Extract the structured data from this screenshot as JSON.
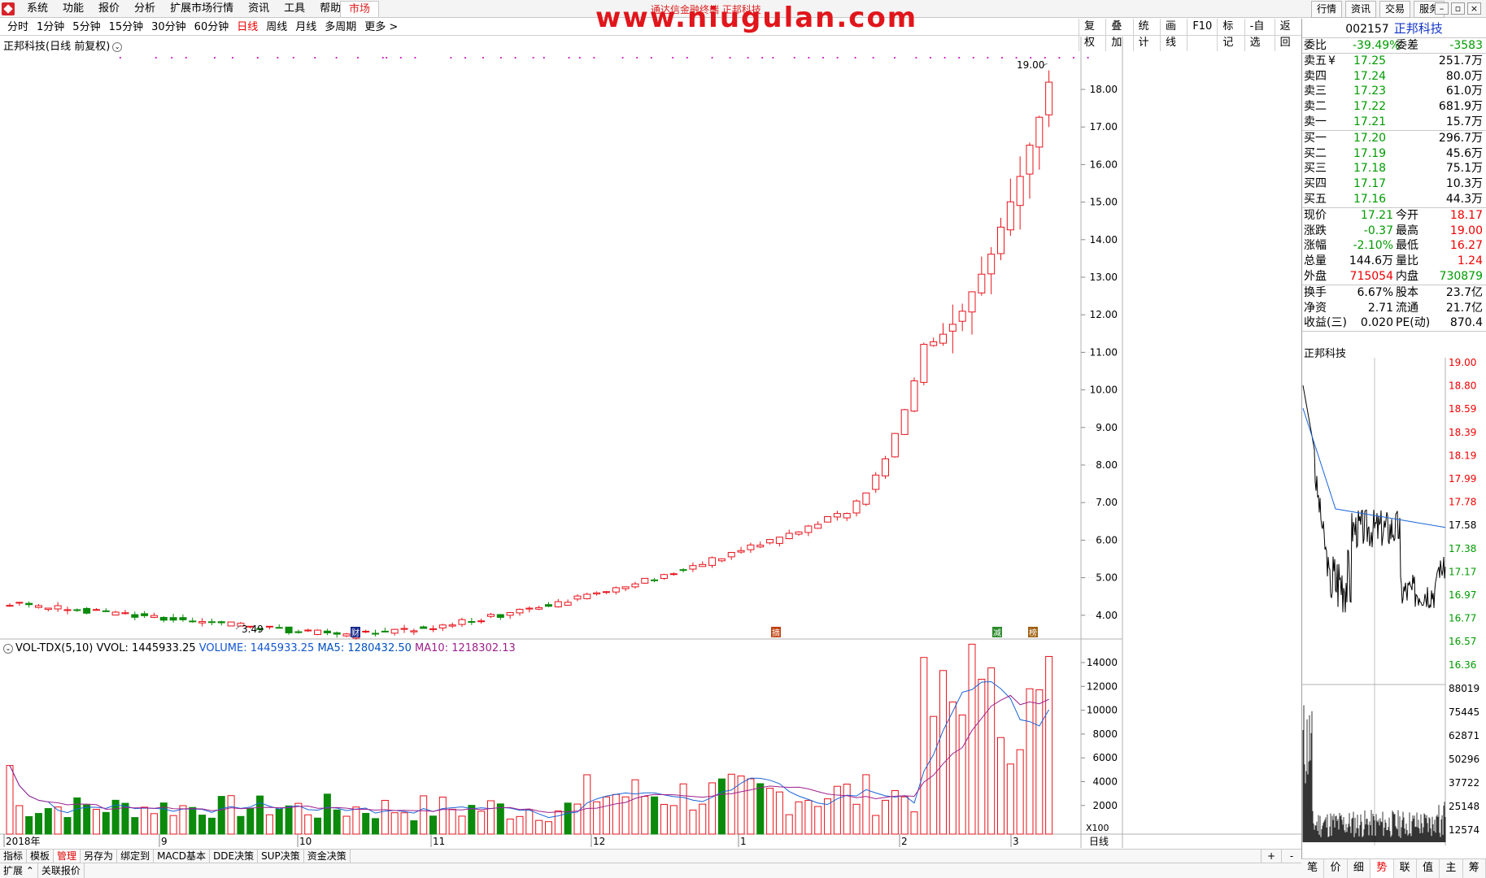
{
  "menu": {
    "items": [
      "系统",
      "功能",
      "报价",
      "分析",
      "扩展市场行情",
      "资讯",
      "工具",
      "帮助"
    ],
    "market_tab": "市场",
    "center_title": "通达信金融终端 正邦科技",
    "right_tabs": [
      "行情",
      "资讯",
      "交易",
      "服务"
    ],
    "window_buttons": [
      "–",
      "▫",
      "×"
    ]
  },
  "watermark": "www.niugulan.com",
  "periods": {
    "items": [
      "分时",
      "1分钟",
      "5分钟",
      "15分钟",
      "30分钟",
      "60分钟",
      "日线",
      "周线",
      "月线",
      "多周期",
      "更多 >"
    ],
    "active_index": 6
  },
  "tools": [
    "复权",
    "叠加",
    "统计",
    "画线",
    "F10",
    "标记",
    "-自选",
    "返回"
  ],
  "main_chart": {
    "title": "正邦科技(日线 前复权)",
    "y_ticks": [
      "18.00",
      "17.00",
      "16.00",
      "15.00",
      "14.00",
      "13.00",
      "12.00",
      "11.00",
      "10.00",
      "9.00",
      "8.00",
      "7.00",
      "6.00",
      "5.00",
      "4.00"
    ],
    "high_label": "19.00",
    "low_label": "3.49",
    "event_markers": [
      "财",
      "摘",
      "减",
      "榜"
    ]
  },
  "volume_chart": {
    "indicator": "VOL-TDX(5,10)",
    "vvol": "VVOL: 1445933.25",
    "volume": "VOLUME: 1445933.25",
    "ma5": "MA5: 1280432.50",
    "ma10": "MA10: 1218302.13",
    "y_ticks": [
      "14000",
      "12000",
      "10000",
      "8000",
      "6000",
      "4000",
      "2000"
    ],
    "unit": "X100"
  },
  "x_axis": {
    "labels": [
      "2018年",
      "9",
      "10",
      "11",
      "12",
      "1",
      "2",
      "3"
    ],
    "period_label": "日线"
  },
  "colors": {
    "up": "#e8141c",
    "down": "#0b8a0b",
    "ma5": "#1a63d8",
    "ma10": "#a0208e"
  },
  "bottom_tabs": [
    "指标",
    "模板",
    "管理",
    "另存为",
    "绑定到",
    "MACD基本",
    "DDE决策",
    "SUP决策",
    "资金决策"
  ],
  "bottom_tabs_active": 2,
  "bottom_plus": "+",
  "bottom_minus": "-",
  "bottom_tabs2": [
    "扩展",
    "关联报价"
  ],
  "quote": {
    "code": "002157",
    "name": "正邦科技",
    "weibi_label": "委比",
    "weibi": "-39.49%",
    "weicha_label": "委差",
    "weicha": "-3583",
    "sell": [
      {
        "label": "卖五",
        "mark": "¥",
        "price": "17.25",
        "vol": "251.7万"
      },
      {
        "label": "卖四",
        "mark": "",
        "price": "17.24",
        "vol": "80.0万"
      },
      {
        "label": "卖三",
        "mark": "",
        "price": "17.23",
        "vol": "61.0万"
      },
      {
        "label": "卖二",
        "mark": "",
        "price": "17.22",
        "vol": "681.9万"
      },
      {
        "label": "卖一",
        "mark": "",
        "price": "17.21",
        "vol": "15.7万"
      }
    ],
    "buy": [
      {
        "label": "买一",
        "price": "17.20",
        "vol": "296.7万"
      },
      {
        "label": "买二",
        "price": "17.19",
        "vol": "45.6万"
      },
      {
        "label": "买三",
        "price": "17.18",
        "vol": "75.1万"
      },
      {
        "label": "买四",
        "price": "17.17",
        "vol": "10.3万"
      },
      {
        "label": "买五",
        "price": "17.16",
        "vol": "44.3万"
      }
    ],
    "stats1": [
      {
        "l1": "现价",
        "v1": "17.21",
        "c1": "green",
        "l2": "今开",
        "v2": "18.17",
        "c2": "red"
      },
      {
        "l1": "涨跌",
        "v1": "-0.37",
        "c1": "green",
        "l2": "最高",
        "v2": "19.00",
        "c2": "red"
      },
      {
        "l1": "涨幅",
        "v1": "-2.10%",
        "c1": "green",
        "l2": "最低",
        "v2": "16.27",
        "c2": "red"
      },
      {
        "l1": "总量",
        "v1": "144.6万",
        "c1": "blk",
        "l2": "量比",
        "v2": "1.24",
        "c2": "red"
      },
      {
        "l1": "外盘",
        "v1": "715054",
        "c1": "red",
        "l2": "内盘",
        "v2": "730879",
        "c2": "green"
      }
    ],
    "stats2": [
      {
        "l1": "换手",
        "v1": "6.67%",
        "l2": "股本",
        "v2": "23.7亿"
      },
      {
        "l1": "净资",
        "v1": "2.71",
        "l2": "流通",
        "v2": "21.7亿"
      },
      {
        "l1": "收益(三)",
        "v1": "0.020",
        "l2": "PE(动)",
        "v2": "870.4"
      }
    ]
  },
  "timeshare": {
    "title": "正邦科技",
    "price_ticks": [
      "19.00",
      "18.80",
      "18.59",
      "18.39",
      "18.19",
      "17.99",
      "17.78",
      "17.58",
      "17.38",
      "17.17",
      "16.97",
      "16.77",
      "16.57",
      "16.36"
    ],
    "vol_ticks": [
      "88019",
      "75445",
      "62871",
      "50296",
      "37722",
      "25148",
      "12574"
    ],
    "tabs": [
      "笔",
      "价",
      "细",
      "势",
      "联",
      "值",
      "主",
      "筹"
    ],
    "active_tab": 3
  }
}
